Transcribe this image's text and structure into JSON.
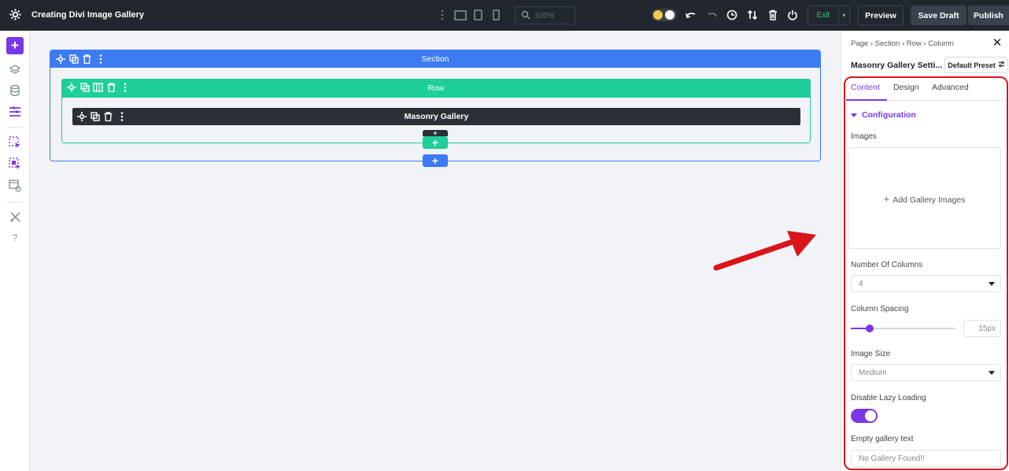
{
  "topbar": {
    "title": "Creating Divi Image Gallery",
    "zoom": "100%",
    "exit_label": "Exit",
    "preview_label": "Preview",
    "save_draft_label": "Save Draft",
    "publish_label": "Publish"
  },
  "canvas": {
    "section_label": "Section",
    "row_label": "Row",
    "module_label": "Masonry Gallery"
  },
  "panel": {
    "breadcrumb": "Page › Section › Row › Column",
    "title": "Masonry Gallery Setti...",
    "preset": "Default Preset",
    "tabs": [
      "Content",
      "Design",
      "Advanced"
    ],
    "active_tab": "Content",
    "group": "Configuration",
    "images_label": "Images",
    "add_images_label": "Add Gallery Images",
    "columns_label": "Number Of Columns",
    "columns_value": "4",
    "spacing_label": "Column Spacing",
    "spacing_value": "15px",
    "image_size_label": "Image Size",
    "image_size_value": "Medium",
    "lazy_label": "Disable Lazy Loading",
    "lazy_enabled": true,
    "empty_text_label": "Empty gallery text",
    "empty_text_value": "No Gallery Found!!"
  },
  "colors": {
    "accent": "#7b37e6",
    "section": "#3c7bf1",
    "row": "#1ecf9a",
    "module": "#2b3036",
    "highlight": "#d9141b"
  }
}
